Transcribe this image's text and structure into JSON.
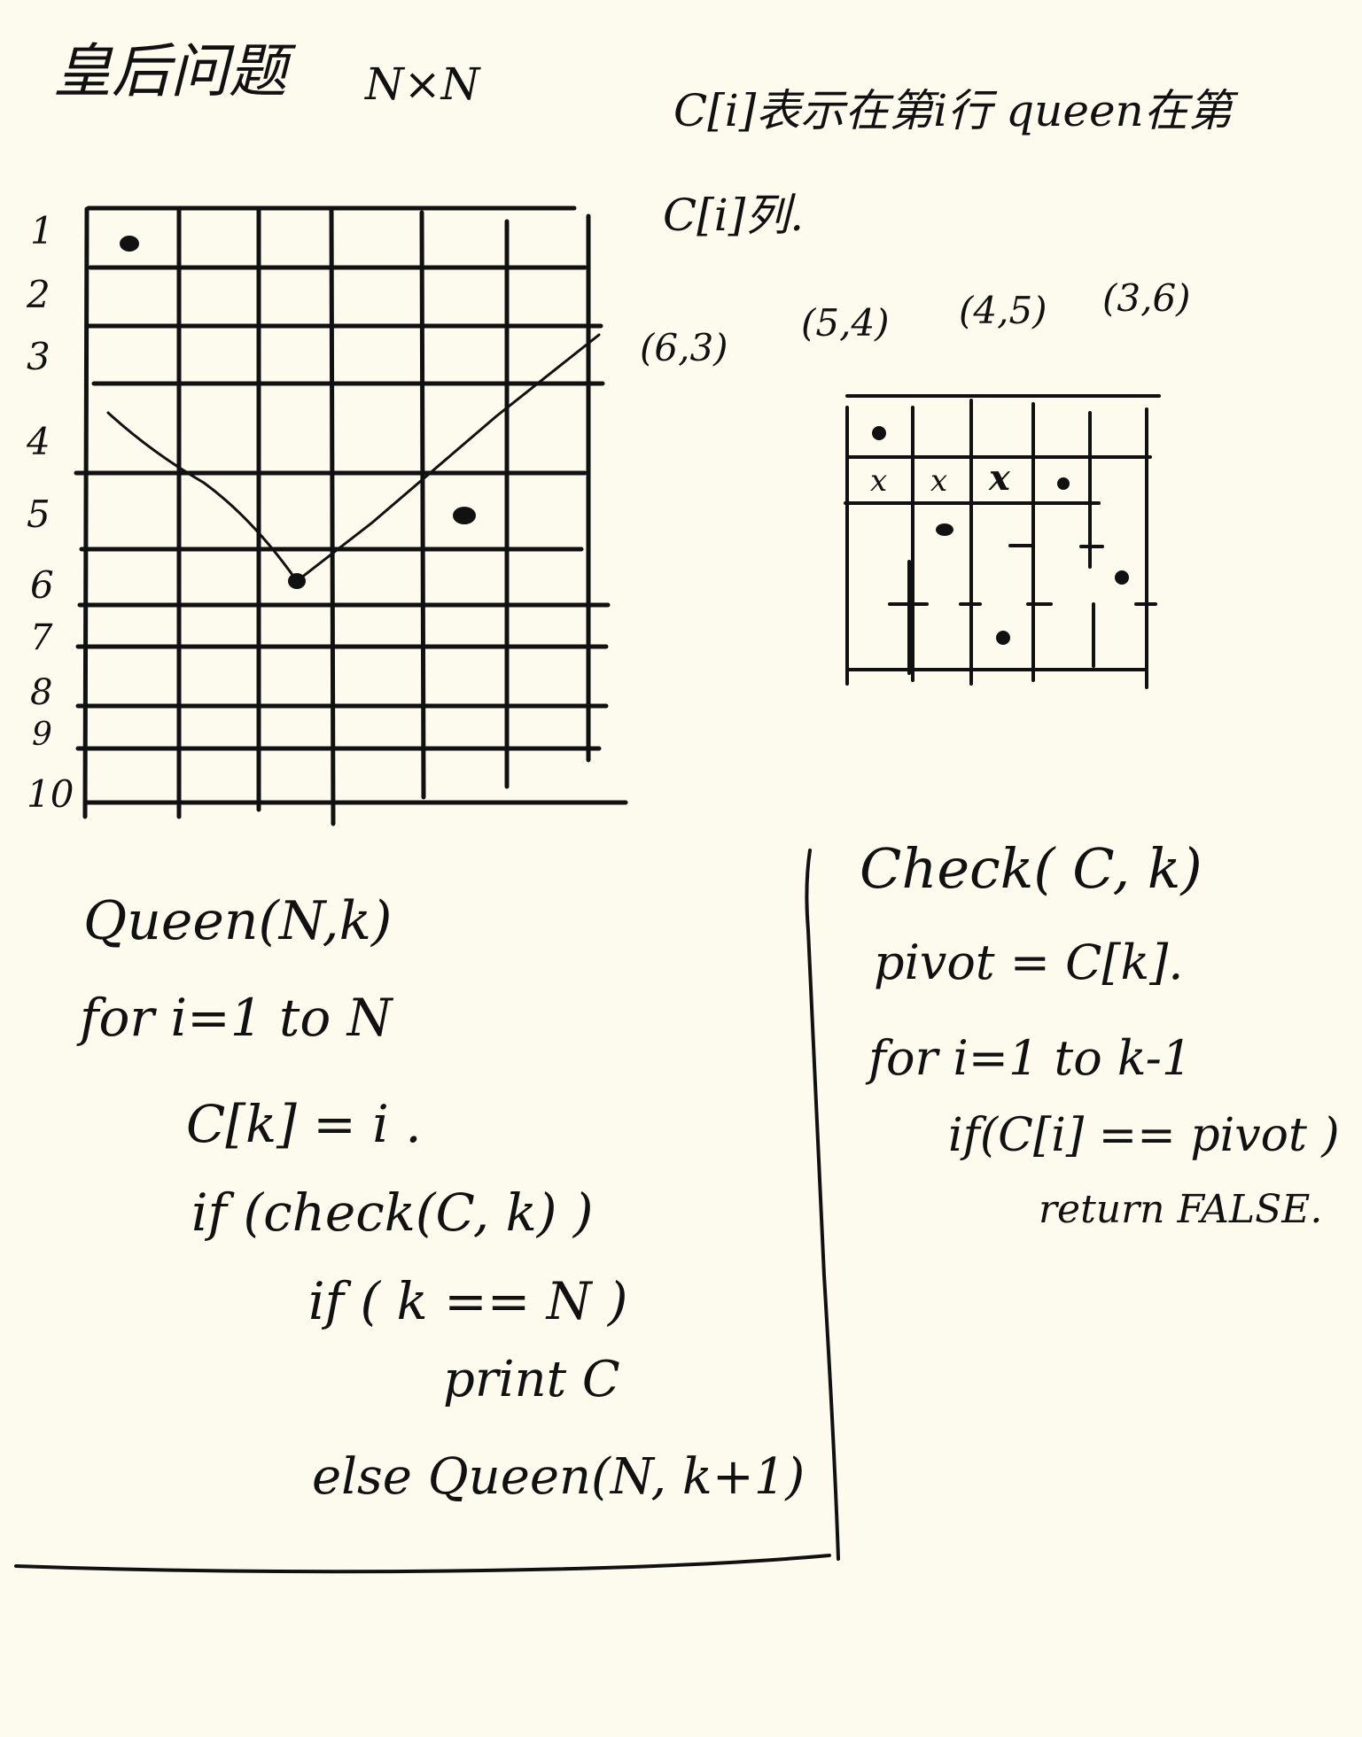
{
  "title": "皇后问题",
  "size_label": "N×N",
  "note_line1": "C[i]表示在第i行 queen在第",
  "note_line2": "C[i]列.",
  "coords": [
    "(6,3)",
    "(5,4)",
    "(4,5)",
    "(3,6)"
  ],
  "row_numbers": [
    "1",
    "2",
    "3",
    "4",
    "5",
    "6",
    "7",
    "8",
    "9",
    "10"
  ],
  "small_grid_marks": [
    "x",
    "x",
    "x"
  ],
  "queen_code": {
    "header": "Queen(N,k)",
    "lines": [
      "for i=1 to N",
      "C[k] = i .",
      "if (check(C, k) )",
      "if ( k == N )",
      "print  C",
      "else  Queen(N, k+1)"
    ]
  },
  "check_code": {
    "header": "Check( C, k)",
    "lines": [
      "pivot = C[k].",
      "for  i=1 to k-1",
      "if(C[i] == pivot )",
      "return  FALSE."
    ]
  }
}
